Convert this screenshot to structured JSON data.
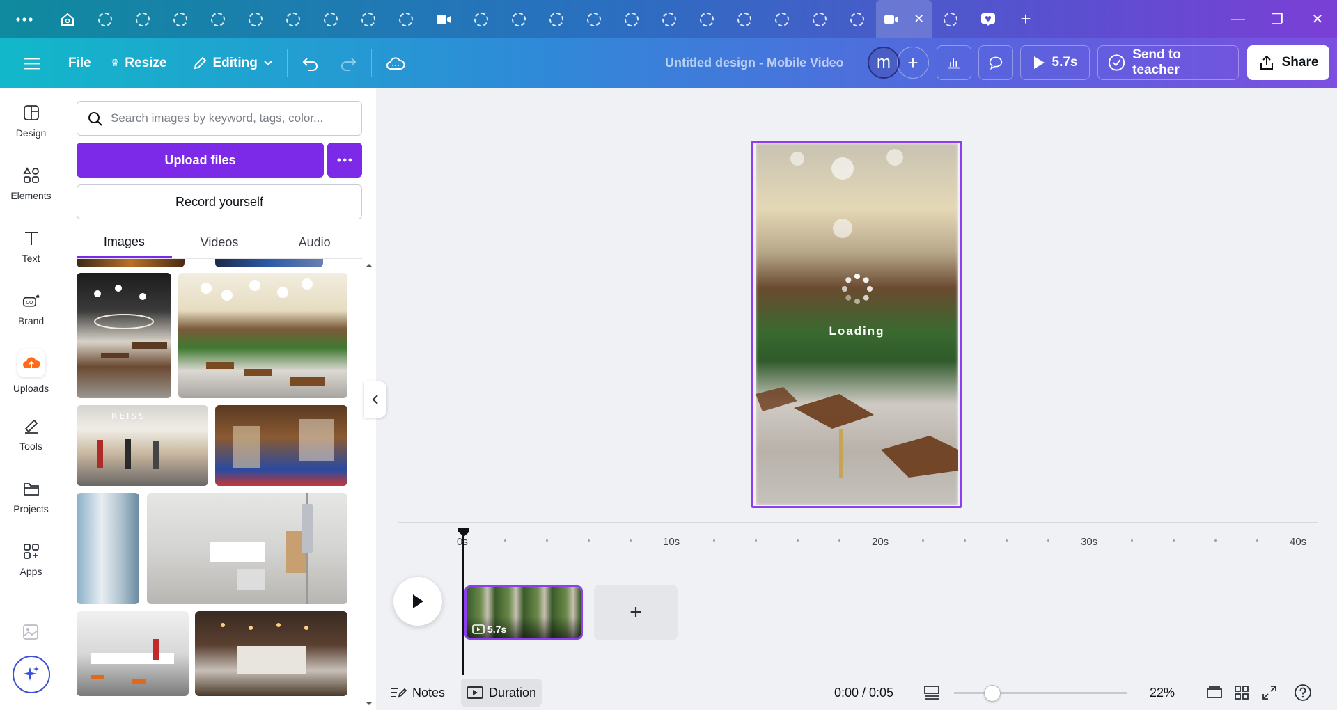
{
  "colors": {
    "accent": "#7d2ae8",
    "selection": "#8b3ff0"
  },
  "browser": {
    "menu_icon": "more-horizontal-icon",
    "tabs": [
      "home-icon",
      "loading-icon",
      "loading-icon",
      "loading-icon",
      "loading-icon",
      "loading-icon",
      "loading-icon",
      "loading-icon",
      "loading-icon",
      "loading-icon",
      "loading-icon",
      "video-icon",
      "loading-icon",
      "loading-icon",
      "loading-icon",
      "loading-icon",
      "loading-icon",
      "loading-icon",
      "loading-icon",
      "loading-icon",
      "loading-icon",
      "loading-icon",
      "loading-icon",
      "video-icon-active",
      "loading-icon",
      "heart-icon"
    ],
    "new_tab": "+"
  },
  "toolbar": {
    "file": "File",
    "resize": "Resize",
    "editing": "Editing",
    "title": "Untitled design - Mobile Video",
    "avatar": "m",
    "duration": "5.7s",
    "send": "Send to teacher",
    "share": "Share"
  },
  "rail": [
    {
      "label": "Design",
      "icon": "design-icon"
    },
    {
      "label": "Elements",
      "icon": "elements-icon"
    },
    {
      "label": "Text",
      "icon": "text-icon"
    },
    {
      "label": "Brand",
      "icon": "brand-icon"
    },
    {
      "label": "Uploads",
      "icon": "cloud-upload-icon"
    },
    {
      "label": "Tools",
      "icon": "tools-icon"
    },
    {
      "label": "Projects",
      "icon": "folder-icon"
    },
    {
      "label": "Apps",
      "icon": "apps-icon"
    }
  ],
  "panel": {
    "search_placeholder": "Search images by keyword, tags, color...",
    "upload": "Upload files",
    "record": "Record yourself",
    "tabs": [
      "Images",
      "Videos",
      "Audio"
    ]
  },
  "canvas": {
    "loading": "Loading"
  },
  "timeline": {
    "ticks": [
      "0s",
      "10s",
      "20s",
      "30s",
      "40s"
    ],
    "clip_duration": "5.7s"
  },
  "bottom": {
    "notes": "Notes",
    "duration": "Duration",
    "time": "0:00 / 0:05",
    "zoom": "22%",
    "zoom_level": 0.22
  }
}
